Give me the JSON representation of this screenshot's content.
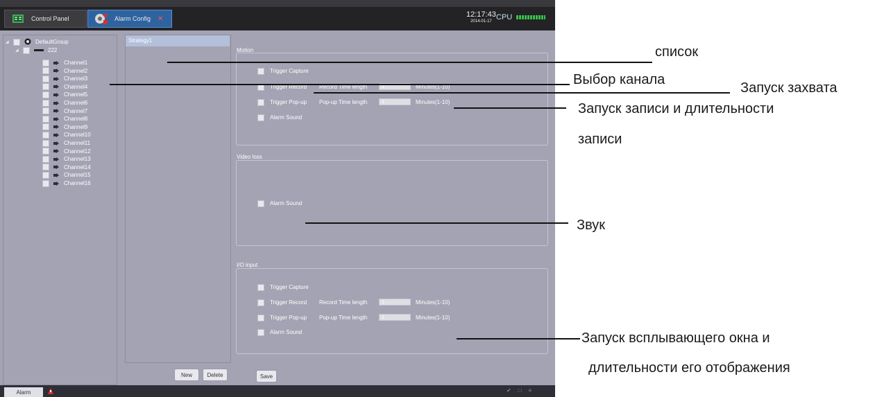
{
  "tabs": {
    "control_panel": "Control Panel",
    "alarm_config": "Alarm Config"
  },
  "status": {
    "time": "12:17:43",
    "date": "2014-01-17",
    "cpu_label": "CPU"
  },
  "tree": {
    "group": "DefaultGroup",
    "device": "222",
    "channels": [
      "Channel1",
      "Channel2",
      "Channel3",
      "Channel4",
      "Channel5",
      "Channel6",
      "Channel7",
      "Channel8",
      "Channel9",
      "Channel10",
      "Channel11",
      "Channel12",
      "Channel13",
      "Channel14",
      "Channel15",
      "Channel16"
    ]
  },
  "strategy": {
    "item": "Strategy1",
    "new_label": "New",
    "delete_label": "Delete"
  },
  "motion": {
    "title": "Motion",
    "trigger_capture": "Trigger Capture",
    "trigger_record": "Trigger Record",
    "record_time_label": "Record Time length",
    "record_time_value": "1",
    "record_minutes": "Minutes(1-10)",
    "trigger_popup": "Trigger Pop-up",
    "popup_time_label": "Pop-up Time length",
    "popup_time_value": "1",
    "popup_minutes": "Minutes(1-10)",
    "alarm_sound": "Alarm Sound"
  },
  "video_loss": {
    "title": "Video loss",
    "alarm_sound": "Alarm Sound"
  },
  "io_input": {
    "title": "I/O input",
    "trigger_capture": "Trigger Capture",
    "trigger_record": "Trigger Record",
    "record_time_label": "Record Time length",
    "record_time_value": "1",
    "record_minutes": "Minutes(1-10)",
    "trigger_popup": "Trigger Pop-up",
    "popup_time_label": "Pop-up Time length",
    "popup_time_value": "1",
    "popup_minutes": "Minutes(1-10)",
    "alarm_sound": "Alarm Sound"
  },
  "save_label": "Save",
  "statusbar": {
    "tab": "Alarm"
  },
  "annotations": {
    "list": "список",
    "channel_select": "Выбор канала",
    "capture": "Запуск  захвата",
    "record_1": "Запуск записи и длительности",
    "record_2": "записи",
    "sound": "Звук",
    "popup_1": "Запуск всплывающего окна и",
    "popup_2": "длительности его отображения"
  }
}
